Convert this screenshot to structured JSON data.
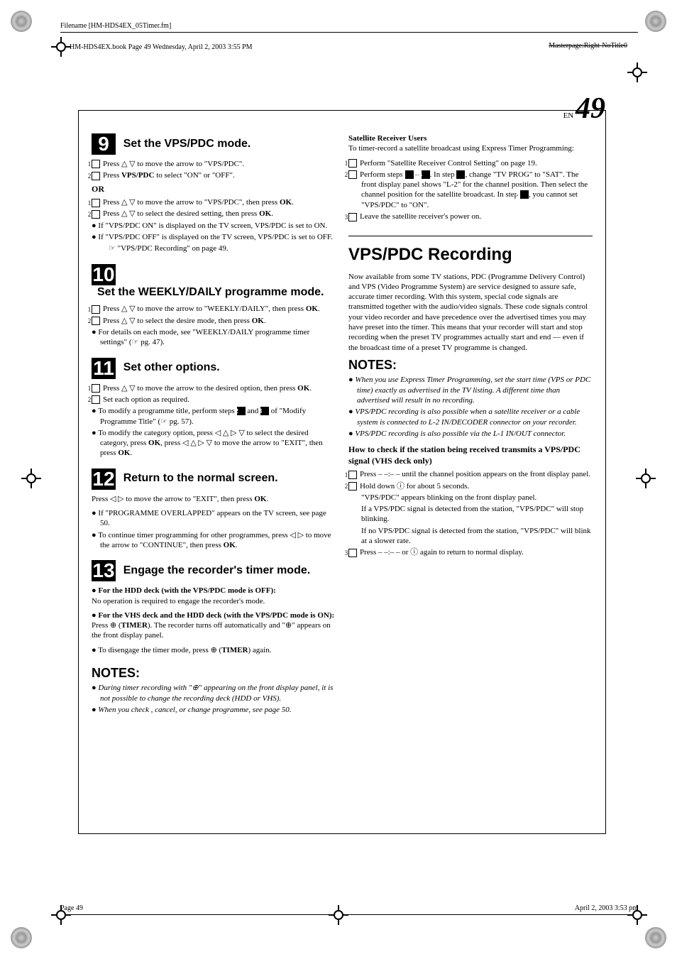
{
  "header": {
    "filename": "Filename [HM-HDS4EX_05Timer.fm]",
    "bookInfo": "HM-HDS4EX.book Page 49 Wednesday, April 2, 2003 3:55 PM",
    "masterpage": "Masterpage:Right-NoTitle0"
  },
  "pageCorner": {
    "en": "EN",
    "num": "49"
  },
  "left": {
    "step9": {
      "num": "9",
      "title": "Set the VPS/PDC mode.",
      "line1": "Press △ ▽ to move the arrow to \"VPS/PDC\".",
      "line2a": "Press ",
      "line2b": "VPS/PDC",
      "line2c": " to select \"ON\" or \"OFF\".",
      "or": "OR",
      "or1a": "Press △ ▽ to move the arrow to \"VPS/PDC\", then press ",
      "or1b": "OK",
      "or1c": ".",
      "or2a": "Press △ ▽ to select the desired setting, then press ",
      "or2b": "OK",
      "or2c": ".",
      "b1": "If \"VPS/PDC ON\" is displayed on the TV screen, VPS/PDC is set to ON.",
      "b2": "If \"VPS/PDC OFF\" is displayed on the TV screen, VPS/PDC is set to OFF.",
      "ref": "\"VPS/PDC Recording\" on page 49."
    },
    "step10": {
      "num": "10",
      "title": "Set the WEEKLY/DAILY programme mode.",
      "l1a": "Press △ ▽ to move the arrow to \"WEEKLY/DAILY\", then press ",
      "l1b": "OK",
      "l1c": ".",
      "l2a": "Press △ ▽ to select the desire mode, then press ",
      "l2b": "OK",
      "l2c": ".",
      "b1": "For details on each mode, see \"WEEKLY/DAILY programme timer settings\" (☞ pg. 47)."
    },
    "step11": {
      "num": "11",
      "title": "Set other options.",
      "l1a": "Press △ ▽ to move the arrow to the desired option, then press ",
      "l1b": "OK",
      "l1c": ".",
      "l2": "Set each option as required.",
      "b1a": "To modify a programme title, perform steps ",
      "b1b": " and ",
      "b1c": " of \"Modify Programme Title\" (☞ pg. 57).",
      "b2a": "To modify the category option, press ◁ △ ▷ ▽ to select the desired category, press ",
      "b2b": "OK",
      "b2c": ", press ◁ △ ▷ ▽ to move the arrow to \"EXIT\", then press ",
      "b2d": "OK",
      "b2e": "."
    },
    "step12": {
      "num": "12",
      "title": "Return to the normal screen.",
      "p1a": "Press ◁ ▷ to move the arrow to \"EXIT\", then press ",
      "p1b": "OK",
      "p1c": ".",
      "b1": "If \"PROGRAMME OVERLAPPED\" appears on the TV screen, see page 50.",
      "b2a": "To continue timer programming for other programmes, press ◁ ▷ to move the arrow to \"CONTINUE\", then press ",
      "b2b": "OK",
      "b2c": "."
    },
    "step13": {
      "num": "13",
      "title": "Engage the recorder's timer mode.",
      "h1": "● For the HDD deck (with the VPS/PDC mode is OFF):",
      "p1": "No operation is required to engage the recorder's mode.",
      "h2": "● For the VHS deck and the HDD deck (with the VPS/PDC mode is ON):",
      "p2a": "Press ⊕ (",
      "p2b": "TIMER",
      "p2c": "). The recorder turns off automatically and \"⊕\" appears on the front display panel.",
      "b1a": "To disengage the timer mode, press ⊕ (",
      "b1b": "TIMER",
      "b1c": ") again."
    },
    "notes": {
      "heading": "NOTES:",
      "n1": "During timer recording with \"⊕\" appearing on the front display panel, it is not possible to change the recording deck (HDD or VHS).",
      "n2": "When you check , cancel, or change programme, see page 50."
    }
  },
  "right": {
    "sat": {
      "heading": "Satellite Receiver Users",
      "p1": "To timer-record a satellite broadcast using Express Timer Programming:",
      "l1": "Perform \"Satellite Receiver Control Setting\" on page 19.",
      "l2a": "Perform steps ",
      "l2b": " – ",
      "l2c": ". In step ",
      "l2d": ", change \"TV PROG\" to \"SAT\". The front display panel shows \"L-2\" for the channel position. Then select the channel position for the satellite broadcast. In step ",
      "l2e": ", you cannot set \"VPS/PDC\" to \"ON\".",
      "l3": "Leave the satellite receiver's power on."
    },
    "vps": {
      "title": "VPS/PDC Recording",
      "para": "Now available from some TV stations, PDC (Programme Delivery Control) and VPS (Video Programme System) are service designed to assure safe, accurate timer recording. With this system, special code signals are transmitted together with the audio/video signals. These code signals control your video recorder and have precedence over the advertised times you may have preset into the timer. This means that your recorder will start and stop recording when the preset TV programmes actually start and end — even if the broadcast time of a preset TV programme is changed.",
      "notesHeading": "NOTES:",
      "n1": "When you use Express Timer Programming, set the start time (VPS or PDC time) exactly as advertised in the TV listing. A different time than advertised will result in no recording.",
      "n2": "VPS/PDC recording is also possible when a satellite receiver or a cable system is connected to L-2 IN/DECODER connector on your recorder.",
      "n3": "VPS/PDC recording is also possible via the L-1 IN/OUT connector.",
      "checkHeading": "How to check if the station being received transmits a VPS/PDC signal (VHS deck only)",
      "c1": "Press – –:– – until the channel position appears on the front display panel.",
      "c2": "Hold down ⓘ for about 5 seconds.",
      "c2s1": "\"VPS/PDC\" appears blinking on the front display panel.",
      "c2s2": "If a VPS/PDC signal is detected from the station, \"VPS/PDC\" will stop blinking.",
      "c2s3": "If no VPS/PDC signal is detected from the station, \"VPS/PDC\" will blink at a slower rate.",
      "c3": "Press – –:– – or ⓘ again to return to normal display."
    }
  },
  "footer": {
    "left": "Page 49",
    "right": "April 2, 2003 3:53 pm"
  }
}
